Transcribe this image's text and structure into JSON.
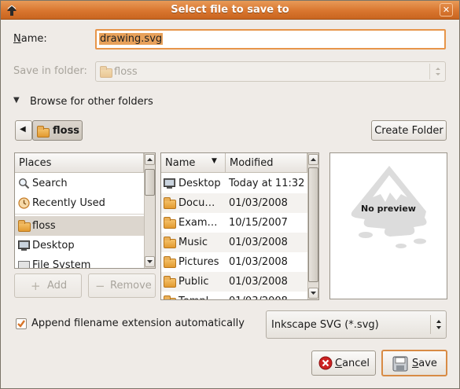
{
  "window": {
    "title": "Select file to save to",
    "close_glyph": "✕"
  },
  "name_row": {
    "label": "Name:",
    "value": "drawing.svg"
  },
  "save_in": {
    "label": "Save in folder:",
    "value": "floss"
  },
  "browse": {
    "label": "Browse for other folders",
    "expander_glyph": "▼"
  },
  "path_bar": {
    "back_glyph": "◀",
    "current_folder": "floss"
  },
  "create_folder_button": "Create Folder",
  "places": {
    "header": "Places",
    "items": [
      {
        "label": "Search",
        "icon": "search-icon"
      },
      {
        "label": "Recently Used",
        "icon": "recent-icon"
      },
      {
        "label": "floss",
        "icon": "home-folder-icon",
        "selected": true
      },
      {
        "label": "Desktop",
        "icon": "desktop-icon"
      },
      {
        "label": "File System",
        "icon": "drive-icon"
      }
    ],
    "add_button": "Add",
    "remove_button": "Remove"
  },
  "files": {
    "columns": {
      "name": "Name",
      "modified": "Modified"
    },
    "sort_glyph": "▼",
    "rows": [
      {
        "name": "Desktop",
        "modified": "Today at 11:32",
        "icon": "desktop-icon"
      },
      {
        "name": "Docu…",
        "modified": "01/03/2008",
        "icon": "folder-icon"
      },
      {
        "name": "Exam…",
        "modified": "10/15/2007",
        "icon": "folder-icon"
      },
      {
        "name": "Music",
        "modified": "01/03/2008",
        "icon": "folder-icon"
      },
      {
        "name": "Pictures",
        "modified": "01/03/2008",
        "icon": "folder-icon"
      },
      {
        "name": "Public",
        "modified": "01/03/2008",
        "icon": "folder-icon"
      },
      {
        "name": "Templ…",
        "modified": "01/03/2008",
        "icon": "folder-icon"
      }
    ]
  },
  "preview": {
    "text": "No preview",
    "logo": "inkscape-logo"
  },
  "append_extension": {
    "label": "Append filename extension automatically",
    "checked": true
  },
  "file_type": {
    "selected": "Inkscape SVG (*.svg)"
  },
  "buttons": {
    "cancel": "Cancel",
    "save": "Save"
  },
  "colors": {
    "title_bar": "#d9762f",
    "focus_ring": "#e7954a",
    "selection": "#dcd6ce",
    "accent_check": "#d8752a"
  }
}
